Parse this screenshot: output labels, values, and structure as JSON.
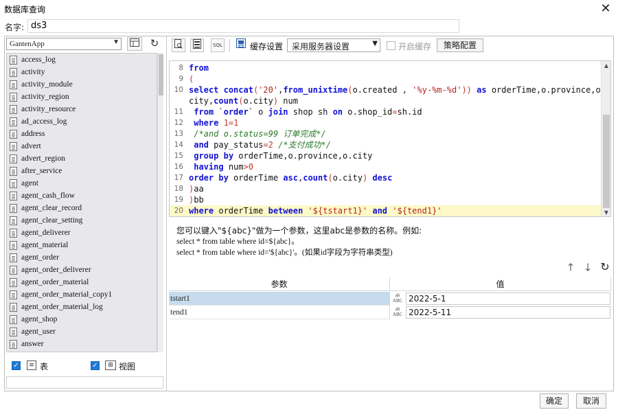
{
  "window": {
    "title": "数据库查询",
    "close_glyph": "✕"
  },
  "name_field": {
    "label": "名字:",
    "value": "ds3"
  },
  "datasource": {
    "selected": "GantenApp"
  },
  "tables": [
    "access_log",
    "activity",
    "activity_module",
    "activity_region",
    "activity_resource",
    "ad_access_log",
    "address",
    "advert",
    "advert_region",
    "after_service",
    "agent",
    "agent_cash_flow",
    "agent_clear_record",
    "agent_clear_setting",
    "agent_deliverer",
    "agent_material",
    "agent_order",
    "agent_order_deliverer",
    "agent_order_material",
    "agent_order_material_copy1",
    "agent_order_material_log",
    "agent_shop",
    "agent_user",
    "answer"
  ],
  "filters": {
    "table_label": "表",
    "view_label": "视图"
  },
  "toolbar": {
    "cache_settings_label": "缓存设置",
    "server_select_value": "采用服务器设置",
    "enable_cache_label": "开启缓存",
    "strategy_button": "策略配置",
    "sql_icon_label": "SQL"
  },
  "editor": {
    "lines": [
      {
        "n": "8",
        "text": "from"
      },
      {
        "n": "9",
        "text": "("
      },
      {
        "n": "10",
        "text": "select concat('20',from_unixtime(o.created , '%y-%m-%d')) as orderTime,o.province,o."
      },
      {
        "n": "",
        "text": "city,count(o.city) num"
      },
      {
        "n": "11",
        "text": " from `order` o join shop sh on o.shop_id=sh.id"
      },
      {
        "n": "12",
        "text": " where 1=1"
      },
      {
        "n": "13",
        "text": " /*and o.status=99 订单完成*/"
      },
      {
        "n": "14",
        "text": " and pay_status=2 /*支付成功*/"
      },
      {
        "n": "15",
        "text": " group by orderTime,o.province,o.city"
      },
      {
        "n": "16",
        "text": " having num>0"
      },
      {
        "n": "17",
        "text": "order by orderTime asc,count(o.city) desc"
      },
      {
        "n": "18",
        "text": ")aa"
      },
      {
        "n": "19",
        "text": ")bb"
      },
      {
        "n": "20",
        "text": "where orderTime between '${tstart1}' and '${tend1}'"
      }
    ]
  },
  "hint": {
    "line1": "您可以键入\"${abc}\"做为一个参数，这里abc是参数的名称。例如:",
    "line2": "select * from table where id=${abc}。",
    "line3": "select * from table where id='${abc}'。(如果id字段为字符串类型)"
  },
  "params": {
    "header_name": "参数",
    "header_value": "值",
    "rows": [
      {
        "name": "tstart1",
        "value": "2022-5-1"
      },
      {
        "name": "tend1",
        "value": "2022-5-11"
      }
    ]
  },
  "buttons": {
    "ok": "确定",
    "cancel": "取消"
  }
}
